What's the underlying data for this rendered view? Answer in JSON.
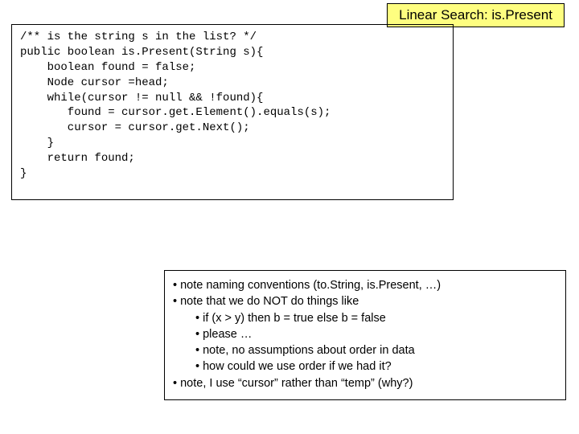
{
  "title": "Linear Search: is.Present",
  "code_lines": [
    "/** is the string s in the list? */",
    "public boolean is.Present(String s){",
    "    boolean found = false;",
    "    Node cursor =head;",
    "    while(cursor != null && !found){",
    "       found = cursor.get.Element().equals(s);",
    "       cursor = cursor.get.Next();",
    "    }",
    "    return found;",
    "}"
  ],
  "notes": {
    "items": [
      {
        "level": 1,
        "text": "note naming conventions (to.String, is.Present, …)"
      },
      {
        "level": 1,
        "text": "note that we do NOT do things like"
      },
      {
        "level": 2,
        "text": "if (x > y) then b = true else b = false"
      },
      {
        "level": 2,
        "text": "please …"
      },
      {
        "level": 2,
        "text": "note, no assumptions about order in data"
      },
      {
        "level": 2,
        "text": "how could we use order if we had it?"
      },
      {
        "level": 1,
        "text": "note, I use “cursor” rather than “temp” (why?)"
      }
    ]
  }
}
